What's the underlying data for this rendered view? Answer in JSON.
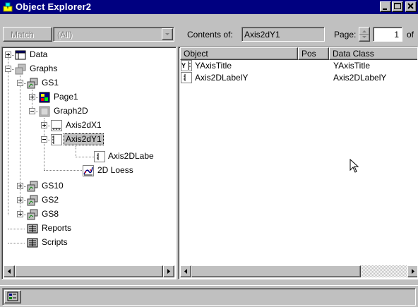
{
  "window": {
    "title": "Object Explorer2"
  },
  "toolbar": {
    "match_label": "Match",
    "match_value": "(All)",
    "contents_label": "Contents of:",
    "contents_value": "Axis2dY1",
    "page_label": "Page:",
    "page_value": "1",
    "page_of": "of"
  },
  "tree": {
    "items": [
      {
        "label": "Data",
        "icon": "data-icon"
      },
      {
        "label": "Graphs",
        "icon": "graphs-folder-icon"
      },
      {
        "label": "GS1",
        "icon": "graph-sheet-icon"
      },
      {
        "label": "Page1",
        "icon": "page-icon"
      },
      {
        "label": "Graph2D",
        "icon": "graph2d-icon"
      },
      {
        "label": "Axis2dX1",
        "icon": "x-axis-icon"
      },
      {
        "label": "Axis2dY1",
        "icon": "y-axis-icon"
      },
      {
        "label": "Axis2DLabe",
        "icon": "axis-label-icon"
      },
      {
        "label": "2D Loess",
        "icon": "loess-plot-icon"
      },
      {
        "label": "GS10",
        "icon": "graph-sheet-icon"
      },
      {
        "label": "GS2",
        "icon": "graph-sheet-icon"
      },
      {
        "label": "GS8",
        "icon": "graph-sheet-icon"
      },
      {
        "label": "Reports",
        "icon": "reports-icon"
      },
      {
        "label": "Scripts",
        "icon": "scripts-icon"
      }
    ]
  },
  "list": {
    "columns": [
      "Object",
      "Pos",
      "Data Class"
    ],
    "rows": [
      {
        "object": "YAxisTitle",
        "pos": "",
        "data_class": "YAxisTitle",
        "icon": "y-axis-title-icon"
      },
      {
        "object": "Axis2DLabelY",
        "pos": "",
        "data_class": "Axis2DLabelY",
        "icon": "axis-label-icon"
      }
    ]
  },
  "colors": {
    "titlebar": "#000080",
    "face": "#c0c0c0",
    "selection": "#c0c0c0"
  }
}
